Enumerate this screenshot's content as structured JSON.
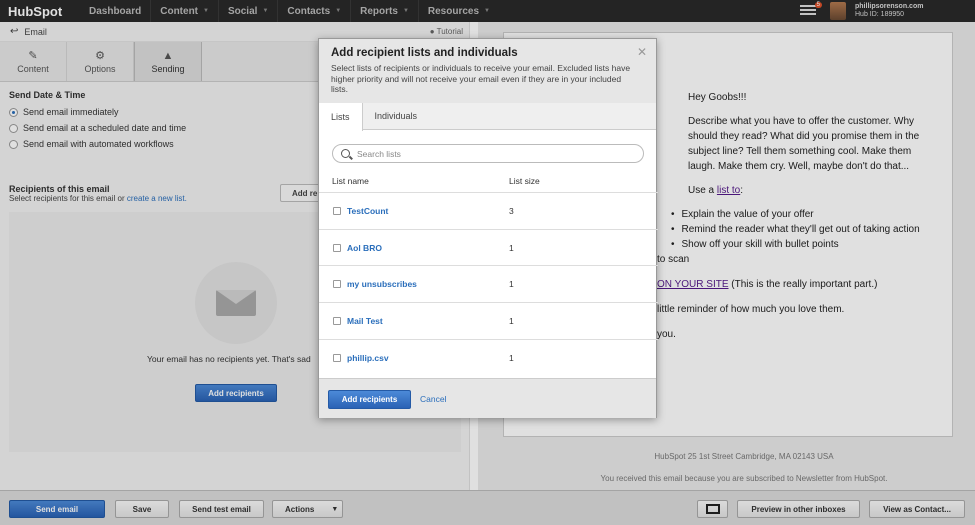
{
  "nav": {
    "logo": "HubSpot",
    "items": [
      {
        "label": "Dashboard",
        "caret": false
      },
      {
        "label": "Content",
        "caret": true
      },
      {
        "label": "Social",
        "caret": true
      },
      {
        "label": "Contacts",
        "caret": true
      },
      {
        "label": "Reports",
        "caret": true
      },
      {
        "label": "Resources",
        "caret": true
      }
    ],
    "notification_count": "5",
    "account_name": "phillipsorenson.com",
    "hub_id": "Hub ID: 189950"
  },
  "left": {
    "back_label": "Email",
    "tutorial_label": "Tutorial",
    "tabs": [
      {
        "label": "Content",
        "icon": "pencil-icon"
      },
      {
        "label": "Options",
        "icon": "gear-icon"
      },
      {
        "label": "Sending",
        "icon": "send-icon"
      }
    ],
    "send_title": "Send Date & Time",
    "radios": [
      {
        "label": "Send email immediately",
        "selected": true
      },
      {
        "label": "Send email at a scheduled date and time",
        "selected": false
      },
      {
        "label": "Send email with automated workflows",
        "selected": false
      }
    ],
    "recip_title": "Recipients of this email",
    "recip_sub": "Select recipients for this email or",
    "recip_link": "create a new list.",
    "add_button_partial": "Add re",
    "no_recipients": "Your email has no recipients yet. That's sad",
    "add_recipients": "Add recipients"
  },
  "preview": {
    "greeting": "Hey Goobs!!!",
    "para1": "Describe what you have to offer the customer. Why should they read? What did you promise them in the subject line? Tell them something cool. Make them laugh. Make them cry. Well, maybe don't do that...",
    "use_a": "Use a",
    "list_link": "list to",
    "colon": ":",
    "bullets": [
      "Explain the value of your offer",
      "Remind the reader what they'll get out of taking action",
      "Show off your skill with bullet points"
    ],
    "to_scan": "to scan",
    "site_link": "ON YOUR SITE",
    "site_note": "(This is the really important part.)",
    "reminder": "little reminder of how much you love them.",
    "you": "you.",
    "footer_address": "HubSpot   25 1st Street   Cambridge,  MA   02143   USA",
    "footer_note": "You received this email because you are subscribed to Newsletter from HubSpot."
  },
  "bottom": {
    "send": "Send email",
    "save": "Save",
    "test": "Send test email",
    "actions": "Actions",
    "preview_inboxes": "Preview in other inboxes",
    "view_contact": "View as Contact..."
  },
  "modal": {
    "title": "Add recipient lists and individuals",
    "description": "Select lists of recipients or individuals to receive your email. Excluded lists have higher priority and will not receive your email even if they are in your included lists.",
    "tabs": [
      "Lists",
      "Individuals"
    ],
    "search_placeholder": "Search lists",
    "col_name": "List name",
    "col_size": "List size",
    "lists": [
      {
        "name": "TestCount",
        "size": "3"
      },
      {
        "name": "Aol BRO",
        "size": "1"
      },
      {
        "name": "my unsubscribes",
        "size": "1"
      },
      {
        "name": "Mail Test",
        "size": "1"
      },
      {
        "name": "phillip.csv",
        "size": "1"
      }
    ],
    "add_button": "Add recipients",
    "cancel": "Cancel"
  },
  "colors": {
    "accent": "#2a6ebb",
    "nav_bg": "#2a2a2a",
    "button_blue": "#2a62b5"
  }
}
